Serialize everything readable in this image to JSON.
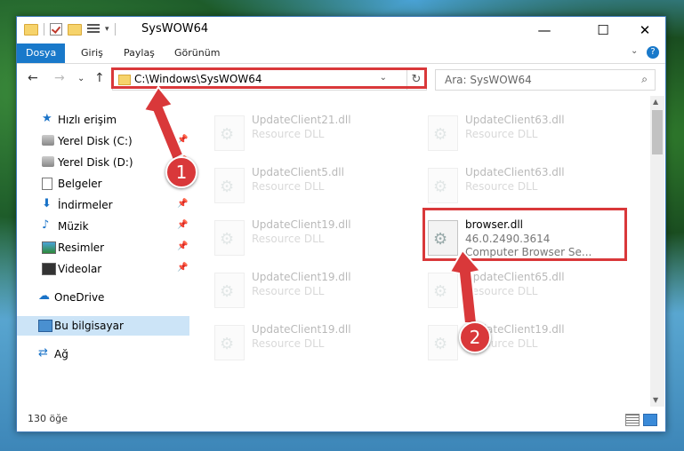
{
  "window": {
    "title": "SysWOW64",
    "minimize": "—",
    "maximize": "☐",
    "close": "✕"
  },
  "ribbon": {
    "tabs": [
      "Dosya",
      "Giriş",
      "Paylaş",
      "Görünüm"
    ],
    "expand": "⌄",
    "help": "?"
  },
  "nav": {
    "back": "←",
    "forward": "→",
    "recent": "⌄",
    "up": "↑",
    "address": "C:\\Windows\\SysWOW64",
    "address_dropdown": "⌄",
    "refresh": "↻",
    "search_placeholder": "Ara: SysWOW64",
    "search_icon": "⌕"
  },
  "sidebar": {
    "items": [
      {
        "label": "Hızlı erişim",
        "icon": "star-icon",
        "glyph": "★",
        "pinned": false
      },
      {
        "label": "Yerel Disk (C:)",
        "icon": "drive-icon",
        "glyph": "",
        "pinned": true
      },
      {
        "label": "Yerel Disk (D:)",
        "icon": "drive-icon",
        "glyph": "",
        "pinned": true
      },
      {
        "label": "Belgeler",
        "icon": "document-icon",
        "glyph": "",
        "pinned": true
      },
      {
        "label": "İndirmeler",
        "icon": "download-icon",
        "glyph": "⬇",
        "pinned": true
      },
      {
        "label": "Müzik",
        "icon": "music-icon",
        "glyph": "♪",
        "pinned": true
      },
      {
        "label": "Resimler",
        "icon": "pictures-icon",
        "glyph": "",
        "pinned": true
      },
      {
        "label": "Videolar",
        "icon": "video-icon",
        "glyph": "",
        "pinned": true
      },
      {
        "label": "OneDrive",
        "icon": "cloud-icon",
        "glyph": "☁",
        "pinned": false
      },
      {
        "label": "Bu bilgisayar",
        "icon": "computer-icon",
        "glyph": "",
        "pinned": false,
        "selected": true
      },
      {
        "label": "Ağ",
        "icon": "network-icon",
        "glyph": "⇄",
        "pinned": false
      }
    ],
    "pin_glyph": "📌"
  },
  "files": [
    {
      "name": "UpdateClient21.dll",
      "type": "Resource DLL",
      "faded": true
    },
    {
      "name": "UpdateClient63.dll",
      "type": "Resource DLL",
      "faded": true
    },
    {
      "name": "UpdateClient5.dll",
      "type": "Resource DLL",
      "faded": true
    },
    {
      "name": "UpdateClient63.dll",
      "type": "Resource DLL",
      "faded": true
    },
    {
      "name": "UpdateClient19.dll",
      "type": "Resource DLL",
      "faded": true
    },
    {
      "name": "browser.dll",
      "version": "46.0.2490.3614",
      "type": "Computer Browser Se...",
      "faded": false
    },
    {
      "name": "UpdateClient19.dll",
      "type": "Resource DLL",
      "faded": true
    },
    {
      "name": "UpdateClient65.dll",
      "type": "Resource DLL",
      "faded": true
    },
    {
      "name": "UpdateClient19.dll",
      "type": "Resource DLL",
      "faded": true
    },
    {
      "name": "UpdateClient19.dll",
      "type": "Resource DLL",
      "faded": true
    }
  ],
  "status": {
    "count": "130 öğe"
  },
  "annotations": {
    "step1": "1",
    "step2": "2",
    "highlight_color": "#d9383a"
  }
}
